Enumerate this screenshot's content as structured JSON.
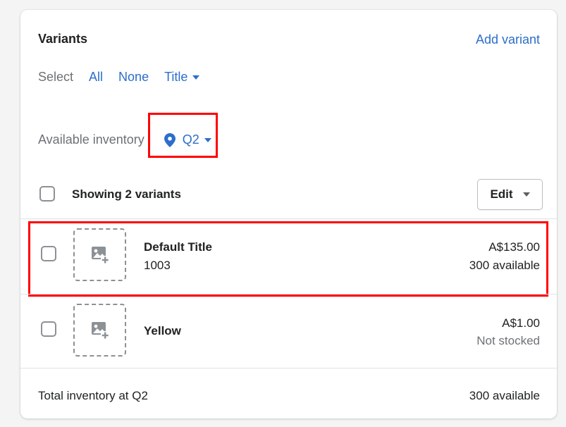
{
  "card": {
    "title": "Variants",
    "add_variant_label": "Add variant"
  },
  "select": {
    "label": "Select",
    "all_label": "All",
    "none_label": "None",
    "title_label": "Title"
  },
  "inventory": {
    "label": "Available inventory",
    "location": "Q2",
    "location_icon": "map-pin-icon"
  },
  "list_header": {
    "showing_label": "Showing 2 variants",
    "edit_label": "Edit"
  },
  "variants": [
    {
      "name": "Default Title",
      "sku": "1003",
      "price": "A$135.00",
      "stock": "300 available",
      "stock_color": "#202223",
      "image_icon": "add-image-icon"
    },
    {
      "name": "Yellow",
      "sku": "",
      "price": "A$1.00",
      "stock": "Not stocked",
      "stock_color": "#6d7175",
      "image_icon": "add-image-icon"
    }
  ],
  "footer": {
    "label": "Total inventory at Q2",
    "value": "300 available"
  },
  "colors": {
    "link": "#2c6ecb",
    "highlight": "#ff0000"
  }
}
